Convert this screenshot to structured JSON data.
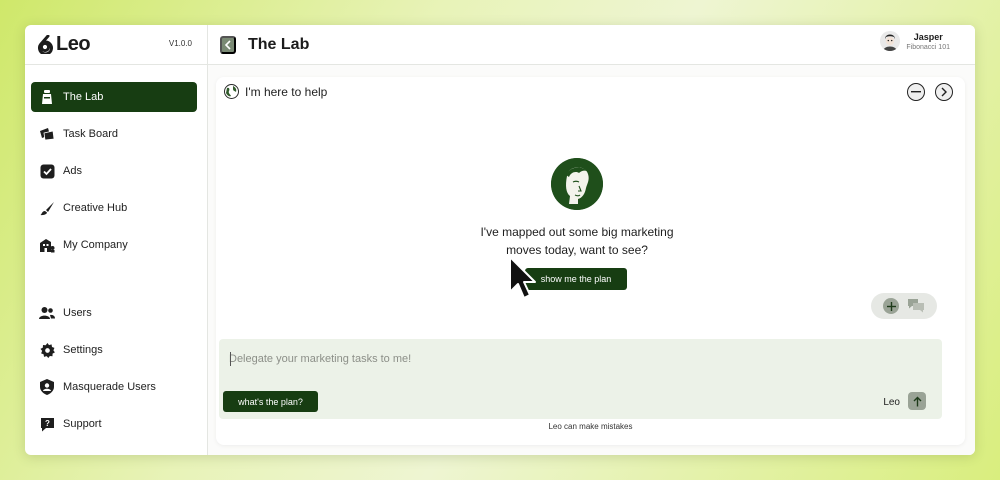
{
  "brand": {
    "name": "Leo",
    "version": "V1.0.0"
  },
  "sidebar": {
    "top_items": [
      {
        "label": "The Lab",
        "icon": "flask-icon",
        "active": true
      },
      {
        "label": "Task Board",
        "icon": "board-icon",
        "active": false
      },
      {
        "label": "Ads",
        "icon": "checkbox-icon",
        "active": false
      },
      {
        "label": "Creative Hub",
        "icon": "brush-icon",
        "active": false
      },
      {
        "label": "My Company",
        "icon": "building-icon",
        "active": false
      }
    ],
    "bottom_items": [
      {
        "label": "Users",
        "icon": "users-icon"
      },
      {
        "label": "Settings",
        "icon": "gear-icon"
      },
      {
        "label": "Masquerade Users",
        "icon": "shield-user-icon"
      },
      {
        "label": "Support",
        "icon": "help-chat-icon"
      }
    ]
  },
  "header": {
    "title": "The Lab",
    "user": {
      "name": "Jasper",
      "subtitle": "Fibonacci 101"
    }
  },
  "assistant": {
    "greeting": "I'm here to help",
    "message_line1": "I've mapped out some big marketing",
    "message_line2": "moves today, want to see?",
    "cta_label": "show me the plan"
  },
  "composer": {
    "placeholder": "Delegate your marketing tasks to me!",
    "suggestion_label": "what's the plan?",
    "model_label": "Leo"
  },
  "disclaimer": "Leo can make mistakes",
  "colors": {
    "accent": "#173d12",
    "composer_bg": "#ecf2e8",
    "muted_button": "#9aa396"
  }
}
